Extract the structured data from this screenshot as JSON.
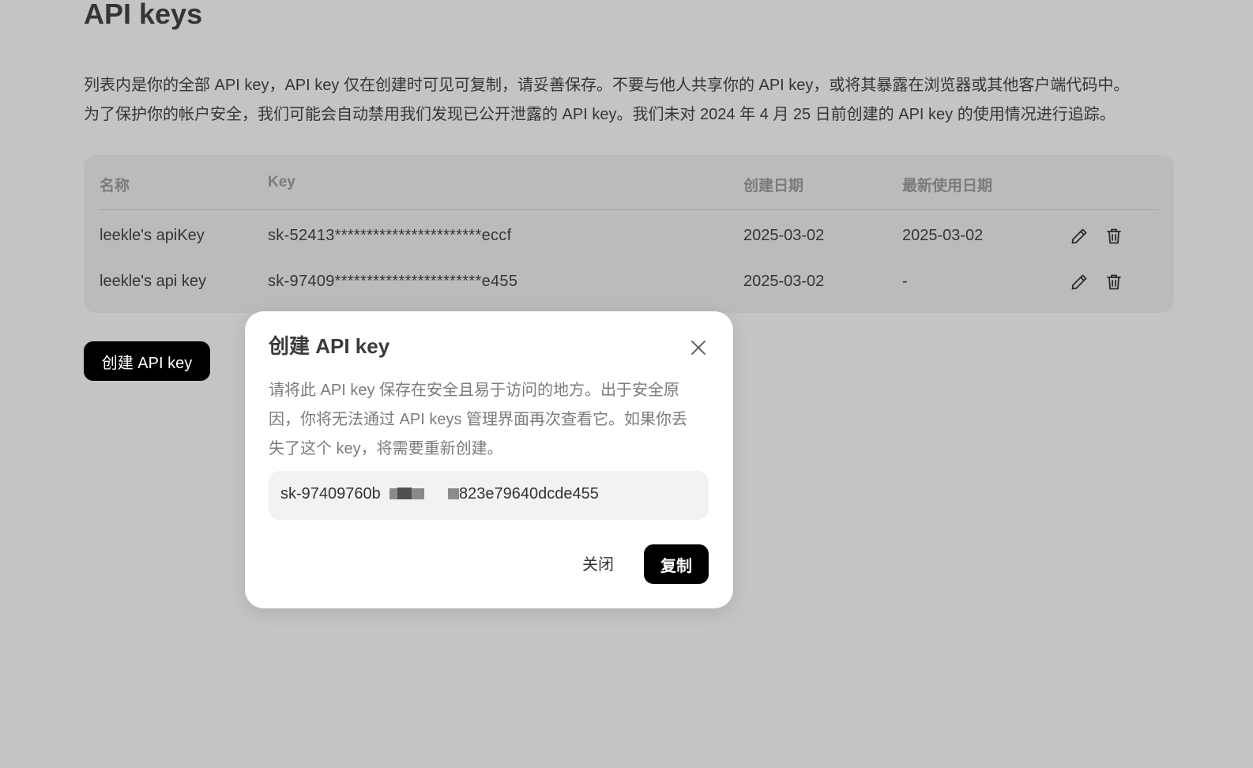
{
  "page": {
    "title": "API keys",
    "description": [
      "列表内是你的全部 API key，API key 仅在创建时可见可复制，请妥善保存。不要与他人共享你的 API key，或将其暴露在浏览器或其他客户端代码中。",
      "为了保护你的帐户安全，我们可能会自动禁用我们发现已公开泄露的 API key。我们未对 2024 年 4 月 25 日前创建的 API key 的使用情况进行追踪。"
    ],
    "create_button_label": "创建 API key"
  },
  "table": {
    "headers": {
      "name": "名称",
      "key": "Key",
      "created": "创建日期",
      "last_used": "最新使用日期"
    },
    "rows": [
      {
        "name": "leekle's apiKey",
        "key": "sk-52413***********************eccf",
        "created": "2025-03-02",
        "last_used": "2025-03-02"
      },
      {
        "name": "leekle's api key",
        "key": "sk-97409***********************e455",
        "created": "2025-03-02",
        "last_used": "-"
      }
    ],
    "row_actions": [
      "pencil-icon",
      "trash-icon"
    ]
  },
  "modal": {
    "title": "创建 API key",
    "text": [
      "请将此 API key 保存在安全且易于访问的地方。出于安全原",
      "因，你将无法通过 API keys 管理界面再次查看它。如果你丢",
      "失了这个 key，将需要重新创建。"
    ],
    "key_prefix": "sk-97409760b",
    "key_suffix": "823e79640dcde455",
    "close_label": "关闭",
    "copy_label": "复制",
    "close_icon": "close-icon"
  },
  "colors": {
    "backdrop": "#c4c4c4",
    "card": "#bbbbbb",
    "primary_button": "#000000",
    "modal": "#ffffff",
    "key_box": "#f2f2f2"
  }
}
